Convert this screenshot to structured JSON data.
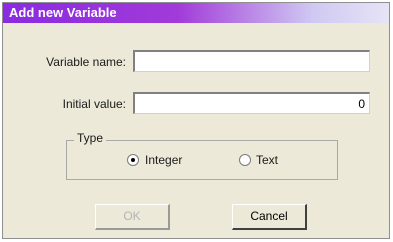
{
  "window": {
    "title": "Add new Variable"
  },
  "form": {
    "variable_name": {
      "label": "Variable name:",
      "value": ""
    },
    "initial_value": {
      "label": "Initial value:",
      "value": "0"
    }
  },
  "type_group": {
    "legend": "Type",
    "options": [
      {
        "label": "Integer",
        "selected": true
      },
      {
        "label": "Text",
        "selected": false
      }
    ]
  },
  "buttons": {
    "ok": {
      "label": "OK",
      "enabled": false
    },
    "cancel": {
      "label": "Cancel",
      "enabled": true
    }
  }
}
